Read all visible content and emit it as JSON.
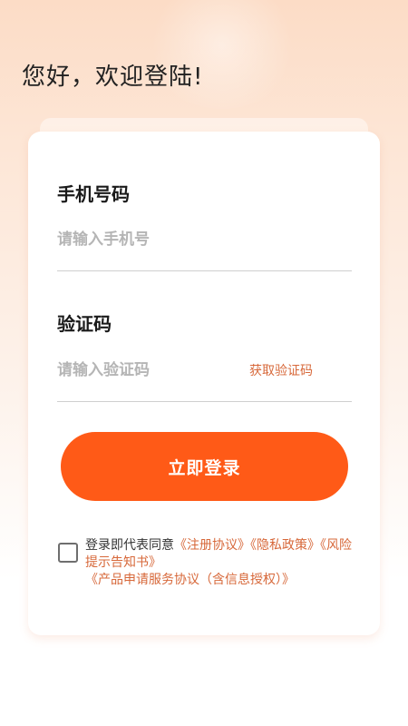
{
  "greeting": "您好，欢迎登陆!",
  "form": {
    "phone_label": "手机号码",
    "phone_placeholder": "请输入手机号",
    "code_label": "验证码",
    "code_placeholder": "请输入验证码",
    "get_code": "获取验证码",
    "login_button": "立即登录"
  },
  "agreement": {
    "prefix": "登录即代表同意",
    "links": [
      "《注册协议》",
      "《隐私政策》",
      "《风险提示告知书》",
      "《产品申请服务协议（含信息授权）》"
    ],
    "checked": false
  },
  "colors": {
    "accent": "#ff5a17",
    "link": "#d7683a"
  }
}
